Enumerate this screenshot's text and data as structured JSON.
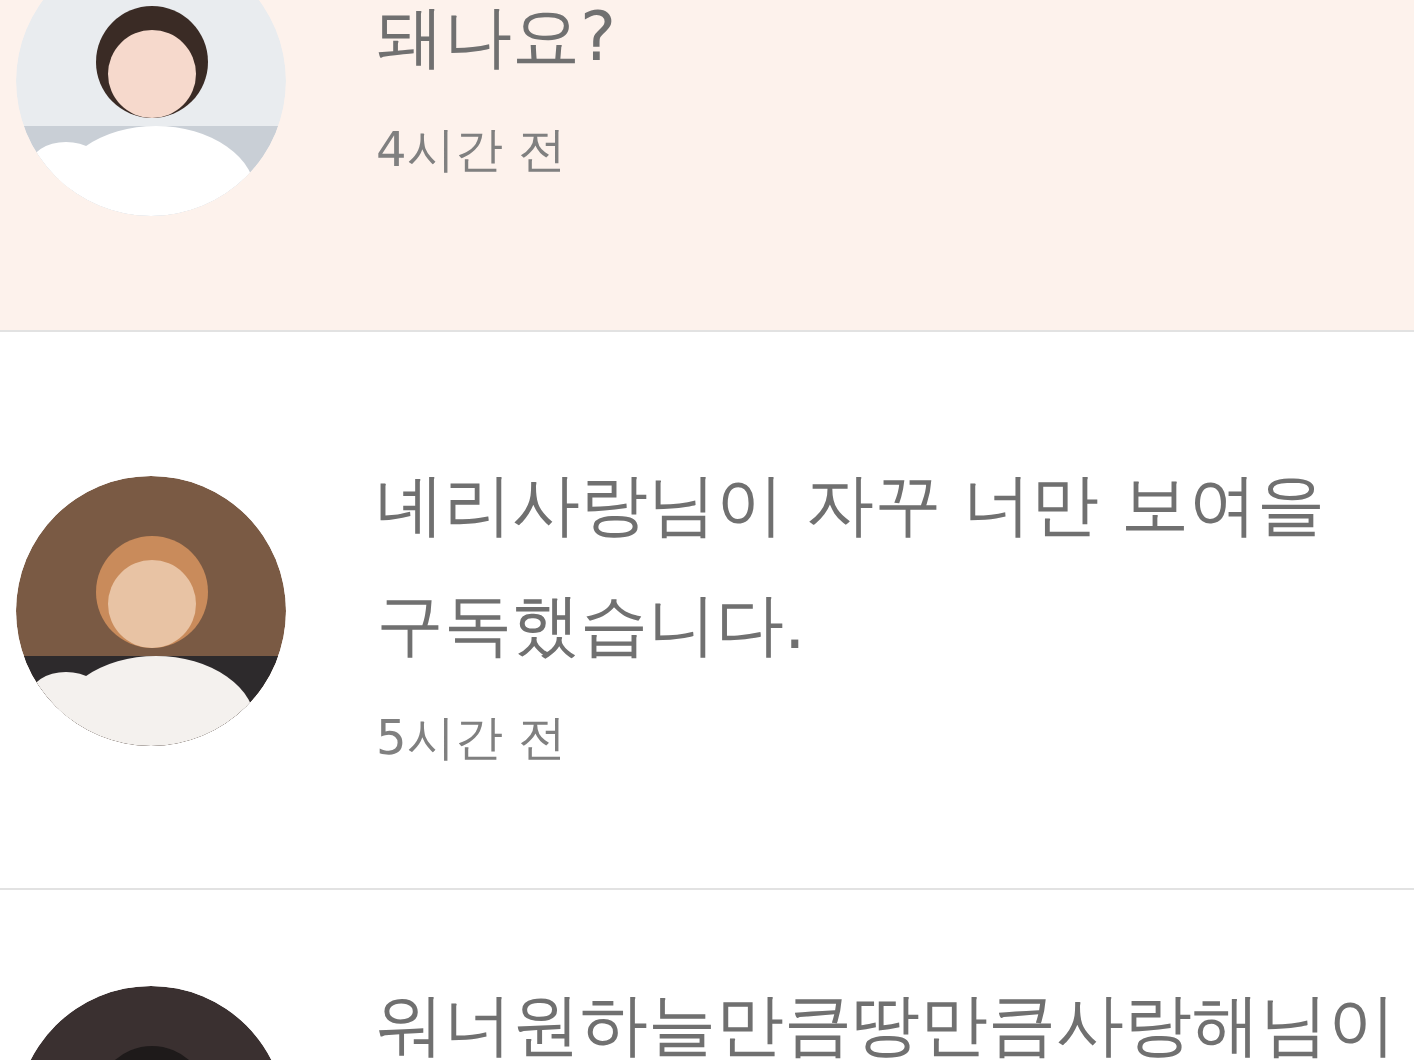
{
  "notifications": [
    {
      "unread": true,
      "message": "돼나요?",
      "time": "4시간 전"
    },
    {
      "unread": false,
      "message": "녜리사랑님이 자꾸 너만 보여을 구독했습니다.",
      "time": "5시간 전"
    },
    {
      "unread": false,
      "message": "워너원하늘만큼땅만큼사랑해님이"
    }
  ]
}
